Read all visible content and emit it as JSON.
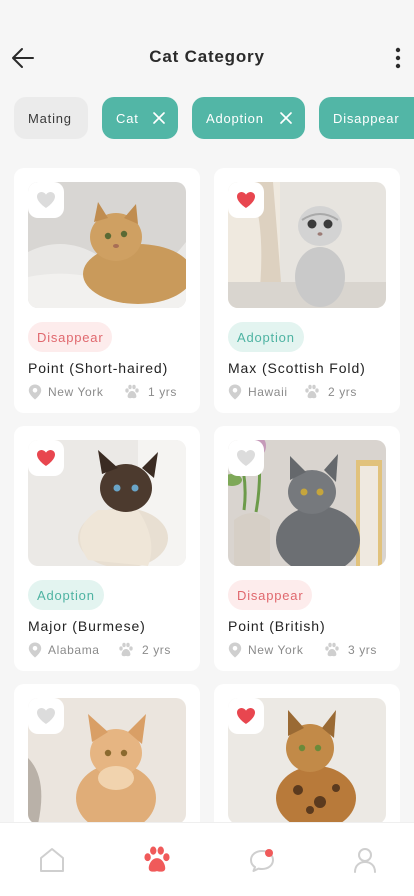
{
  "header": {
    "title": "Cat Category"
  },
  "filters": [
    {
      "label": "Mating",
      "active": false
    },
    {
      "label": "Cat",
      "active": true
    },
    {
      "label": "Adoption",
      "active": true
    },
    {
      "label": "Disappear",
      "active": true
    }
  ],
  "cards": [
    {
      "status": "Disappear",
      "name": "Point (Short-haired)",
      "location": "New York",
      "age": "1 yrs",
      "favorite": false
    },
    {
      "status": "Adoption",
      "name": "Max (Scottish Fold)",
      "location": "Hawaii",
      "age": "2 yrs",
      "favorite": true
    },
    {
      "status": "Adoption",
      "name": "Major (Burmese)",
      "location": "Alabama",
      "age": "2 yrs",
      "favorite": true
    },
    {
      "status": "Disappear",
      "name": "Point (British)",
      "location": "New York",
      "age": "3 yrs",
      "favorite": false
    },
    {
      "status": "",
      "name": "",
      "location": "",
      "age": "",
      "favorite": false
    },
    {
      "status": "",
      "name": "",
      "location": "",
      "age": "",
      "favorite": true
    }
  ],
  "tabbar": {
    "active": "paw-tab",
    "notification": true
  },
  "colors": {
    "accent": "#52b6a6",
    "favorite": "#e8464f",
    "disappear_text": "#e0686e",
    "adoption_text": "#4eb3a2"
  }
}
